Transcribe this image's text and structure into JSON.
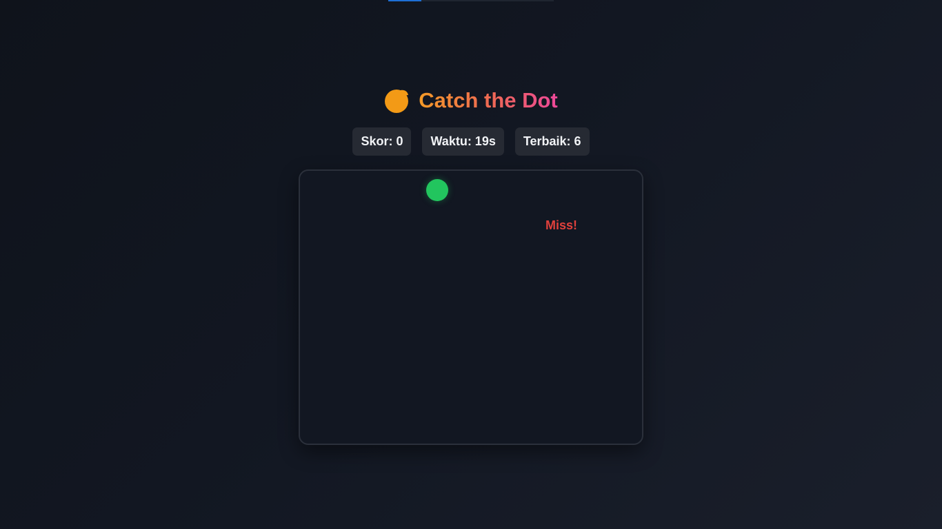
{
  "app": {
    "title": "Catch the Dot",
    "title_icon": "orange-icon",
    "colors": {
      "title_gradient": [
        "#f39a27",
        "#ef6a52",
        "#ec4899"
      ],
      "dot": "#22c55e",
      "miss": "#e0403c",
      "loading_bar": "#1d6fd6"
    }
  },
  "loading_progress": 0.2,
  "stats": {
    "score_label": "Skor: 0",
    "time_label": "Waktu: 19s",
    "best_label": "Terbaik: 6"
  },
  "game": {
    "feedback_text": "Miss!"
  }
}
